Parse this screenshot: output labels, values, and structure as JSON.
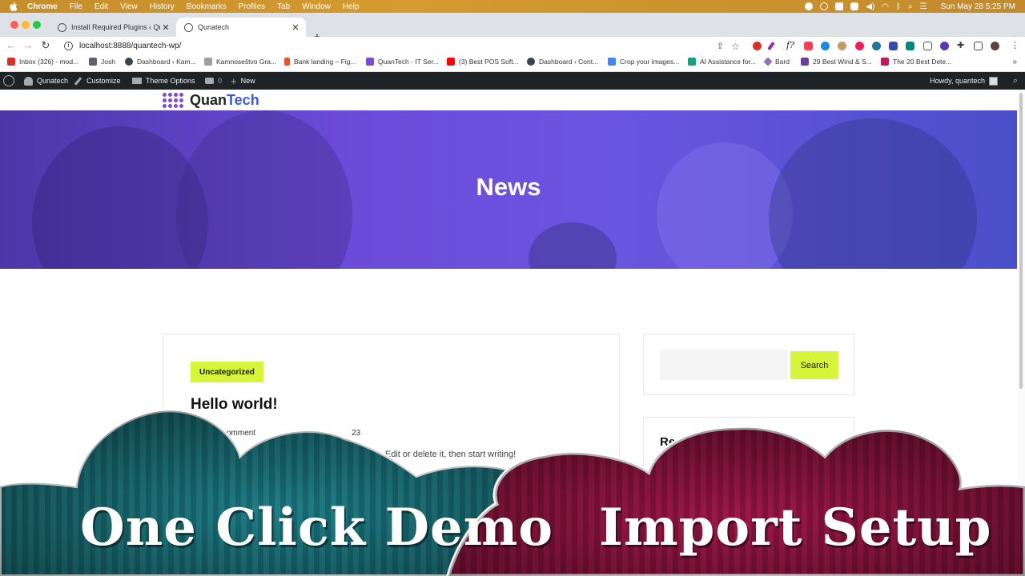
{
  "menubar": {
    "app": "Chrome",
    "items": [
      "File",
      "Edit",
      "View",
      "History",
      "Bookmarks",
      "Profiles",
      "Tab",
      "Window",
      "Help"
    ],
    "clock": "Sun May 28  5:25 PM"
  },
  "tabs": [
    {
      "title": "Install Required Plugins ‹ Quna"
    },
    {
      "title": "Qunatech"
    }
  ],
  "address": {
    "url": "localhost:8888/quantech-wp/"
  },
  "bookmarks": [
    {
      "label": "Inbox (326) - mod...",
      "color": "#d93025"
    },
    {
      "label": "Josh",
      "color": "#5f6368"
    },
    {
      "label": "Dashboard ‹ Kam...",
      "color": "#3c434a"
    },
    {
      "label": "Kamnoseštvo Gra...",
      "color": "#9e9e9e"
    },
    {
      "label": "Bank landing – Fig...",
      "color": "#f24e1e"
    },
    {
      "label": "QuanTech - IT Ser...",
      "color": "#7b4bd6"
    },
    {
      "label": "(3) Best POS Soft...",
      "color": "#ff0000"
    },
    {
      "label": "Dashboard ‹ Cont...",
      "color": "#3c434a"
    },
    {
      "label": "Crop your images...",
      "color": "#4285f4"
    },
    {
      "label": "AI Assistance for...",
      "color": "#10a37f"
    },
    {
      "label": "Bard",
      "color": "#8e75b2"
    },
    {
      "label": "29 Best Wind & S...",
      "color": "#6b3fa0"
    },
    {
      "label": "The 20 Best Dete...",
      "color": "#c2185b"
    }
  ],
  "wpbar": {
    "site": "Qunatech",
    "customize": "Customize",
    "theme_options": "Theme Options",
    "comments": "0",
    "new": "New",
    "howdy": "Howdy, quantech"
  },
  "site": {
    "logo_a": "Quan",
    "logo_b": "Tech",
    "hero_title": "News"
  },
  "post": {
    "category": "Uncategorized",
    "title": "Hello world!",
    "meta_comment": "comment",
    "meta_date": "23",
    "excerpt": "post. Edit or delete it, then start writing!"
  },
  "search": {
    "button": "Search",
    "placeholder": ""
  },
  "recent": {
    "title": "Rece"
  },
  "overlay": {
    "left_text": "One Click Demo",
    "right_text": "Import Setup"
  }
}
